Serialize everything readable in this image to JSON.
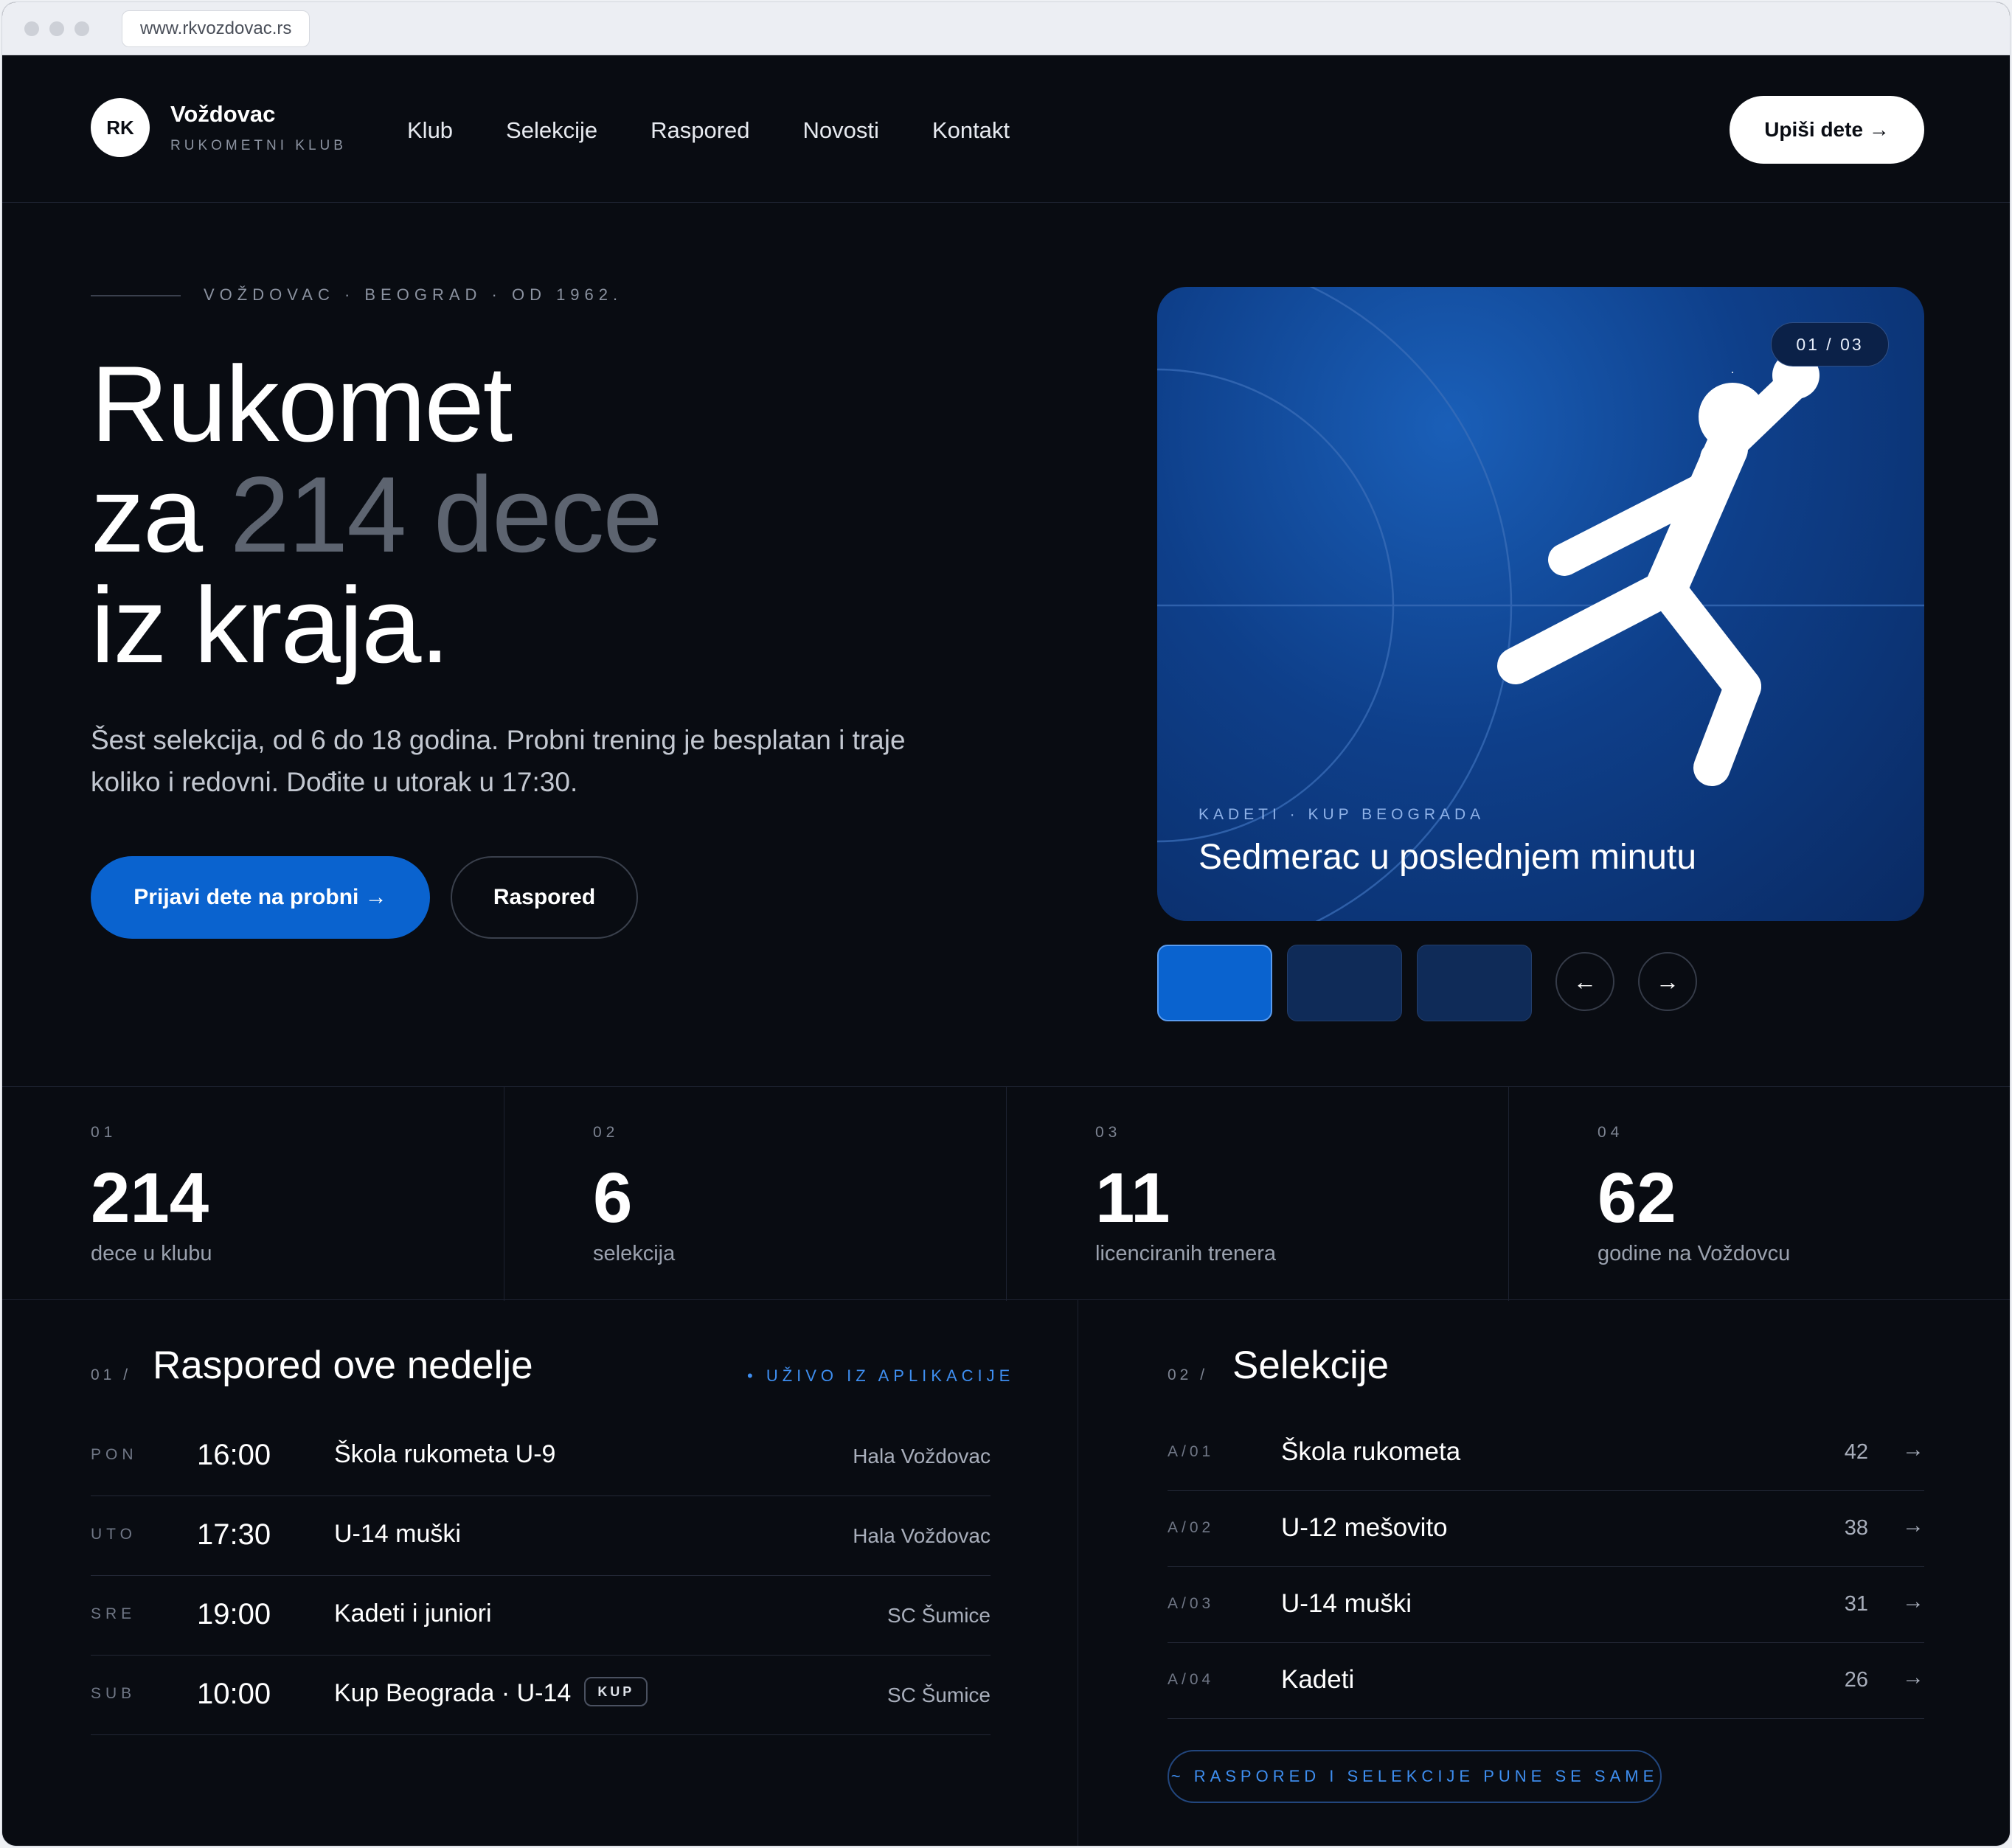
{
  "browser": {
    "url": "www.rkvozdovac.rs"
  },
  "header": {
    "logo_initials": "RK",
    "brand_name": "Voždovac",
    "brand_sub": "RUKOMETNI KLUB",
    "nav": [
      "Klub",
      "Selekcije",
      "Raspored",
      "Novosti",
      "Kontakt"
    ],
    "cta": "Upiši dete →"
  },
  "hero": {
    "eyebrow": "VOŽDOVAC · BEOGRAD · OD 1962.",
    "headline_line1": "Rukomet",
    "headline_line2_pre": "za ",
    "headline_line2_muted": "214 dece",
    "headline_line3": "iz kraja.",
    "lead": "Šest selekcija, od 6 do 18 godina. Probni trening je besplatan i traje koliko i redovni. Dođite u utorak u 17:30.",
    "primary_button": "Prijavi dete na probni →",
    "secondary_button": "Raspored"
  },
  "card": {
    "counter": "01 / 03",
    "eyebrow": "KADETI · KUP BEOGRADA",
    "title": "Sedmerac u poslednjem minutu",
    "prev_icon": "←",
    "next_icon": "→",
    "thumb_colors": [
      "#0a63cf",
      "#0f2b58",
      "#0f2b58"
    ]
  },
  "stats": [
    {
      "idx": "01",
      "value": "214",
      "label": "dece u klubu"
    },
    {
      "idx": "02",
      "value": "6",
      "label": "selekcija"
    },
    {
      "idx": "03",
      "value": "11",
      "label": "licenciranih trenera"
    },
    {
      "idx": "04",
      "value": "62",
      "label": "godine na Voždovcu"
    }
  ],
  "schedule": {
    "idx": "01 /",
    "title": "Raspored ove nedelje",
    "live_label": "• UŽIVO IZ APLIKACIJE",
    "rows": [
      {
        "day": "PON",
        "time": "16:00",
        "name": "Škola rukometa U-9",
        "place": "Hala Voždovac",
        "badge": ""
      },
      {
        "day": "UTO",
        "time": "17:30",
        "name": "U-14 muški",
        "place": "Hala Voždovac",
        "badge": ""
      },
      {
        "day": "SRE",
        "time": "19:00",
        "name": "Kadeti i juniori",
        "place": "SC Šumice",
        "badge": ""
      },
      {
        "day": "SUB",
        "time": "10:00",
        "name": "Kup Beograda · U-14",
        "place": "SC Šumice",
        "badge": "KUP"
      }
    ]
  },
  "selections": {
    "idx": "02 /",
    "title": "Selekcije",
    "rows": [
      {
        "code": "A/01",
        "name": "Škola rukometa",
        "count": "42",
        "arrow": "→"
      },
      {
        "code": "A/02",
        "name": "U-12 mešovito",
        "count": "38",
        "arrow": "→"
      },
      {
        "code": "A/03",
        "name": "U-14 muški",
        "count": "31",
        "arrow": "→"
      },
      {
        "code": "A/04",
        "name": "Kadeti",
        "count": "26",
        "arrow": "→"
      }
    ],
    "note": "~ RASPORED I SELEKCIJE PUNE SE SAME"
  },
  "colors": {
    "accent": "#0a63cf",
    "live": "#3e8ef0",
    "background": "#090c12"
  }
}
